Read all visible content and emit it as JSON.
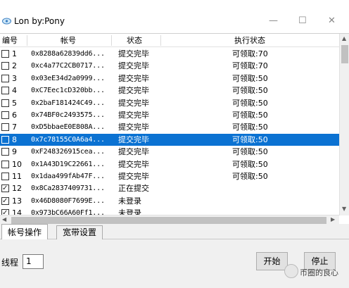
{
  "window": {
    "title": "Lon by:Pony",
    "controls": [
      "—",
      "☐",
      "✕"
    ],
    "top_controls": [
      "—",
      "☐",
      "✕"
    ]
  },
  "list": {
    "columns": [
      "编号",
      "帐号",
      "状态",
      "执行状态"
    ],
    "rows": [
      {
        "checked": false,
        "num": "1",
        "account": "0x8288a62839dd6...",
        "state": "提交完毕",
        "exec": "可领取:70"
      },
      {
        "checked": false,
        "num": "2",
        "account": "0xc4a77C2CB0717...",
        "state": "提交完毕",
        "exec": "可领取:70"
      },
      {
        "checked": false,
        "num": "3",
        "account": "0x03eE34d2a0999...",
        "state": "提交完毕",
        "exec": "可领取:50"
      },
      {
        "checked": false,
        "num": "4",
        "account": "0xC7Eec1cD320bb...",
        "state": "提交完毕",
        "exec": "可领取:50"
      },
      {
        "checked": false,
        "num": "5",
        "account": "0x2baF181424C49...",
        "state": "提交完毕",
        "exec": "可领取:50"
      },
      {
        "checked": false,
        "num": "6",
        "account": "0x74BF0c2493575...",
        "state": "提交完毕",
        "exec": "可领取:50"
      },
      {
        "checked": false,
        "num": "7",
        "account": "0xD5bbaeE0E808A...",
        "state": "提交完毕",
        "exec": "可领取:50"
      },
      {
        "checked": false,
        "num": "8",
        "account": "0x7c78155C0A6a4...",
        "state": "提交完毕",
        "exec": "可领取:50",
        "selected": true
      },
      {
        "checked": false,
        "num": "9",
        "account": "0xF248326915cea...",
        "state": "提交完毕",
        "exec": "可领取:50"
      },
      {
        "checked": false,
        "num": "10",
        "account": "0x1A43D19C22661...",
        "state": "提交完毕",
        "exec": "可领取:50"
      },
      {
        "checked": false,
        "num": "11",
        "account": "0x1daa499fAb47F...",
        "state": "提交完毕",
        "exec": "可领取:50"
      },
      {
        "checked": true,
        "num": "12",
        "account": "0x8Ca2837409731...",
        "state": "正在提交",
        "exec": ""
      },
      {
        "checked": true,
        "num": "13",
        "account": "0x46D8080F7699E...",
        "state": "未登录",
        "exec": ""
      },
      {
        "checked": true,
        "num": "14",
        "account": "0x973bC66A60Ff1...",
        "state": "未登录",
        "exec": ""
      }
    ]
  },
  "tabs": [
    "帐号操作",
    "宽带设置"
  ],
  "panel": {
    "thread_label": "线程",
    "thread_value": "1",
    "start_label": "开始",
    "stop_label": "停止",
    "watermark": "币圈的良心"
  },
  "colors": {
    "selection": "#0b72d2",
    "background": "#ffffff",
    "panel": "#f0f0f0"
  },
  "icons": {
    "app": "cloud-app-icon",
    "watermark": "wechat-logo-icon"
  }
}
